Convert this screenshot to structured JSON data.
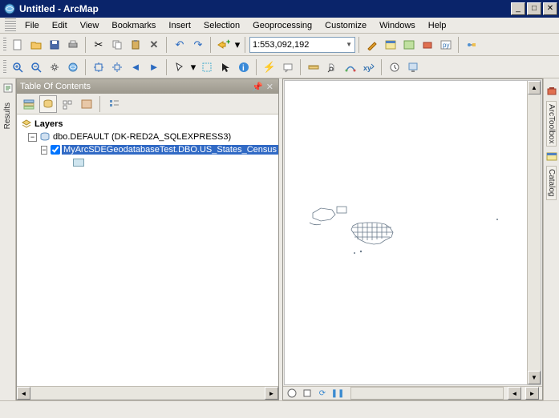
{
  "window": {
    "title": "Untitled - ArcMap"
  },
  "menu": {
    "file": "File",
    "edit": "Edit",
    "view": "View",
    "bookmarks": "Bookmarks",
    "insert": "Insert",
    "selection": "Selection",
    "geoprocessing": "Geoprocessing",
    "customize": "Customize",
    "windows": "Windows",
    "help": "Help"
  },
  "scale": "1:553,092,192",
  "toc": {
    "title": "Table Of Contents",
    "root": "Layers",
    "dataframe": "dbo.DEFAULT (DK-RED2A_SQLEXPRESS3)",
    "layer": "MyArcSDEGeodatabaseTest.DBO.US_States_Census",
    "layer_checked": true
  },
  "sidetabs": {
    "left": "Results",
    "right1": "ArcToolbox",
    "right2": "Catalog"
  },
  "colors": {
    "selection": "#316ac5",
    "swatch_fill": "#cfe5ef",
    "swatch_border": "#7aa0b0"
  }
}
